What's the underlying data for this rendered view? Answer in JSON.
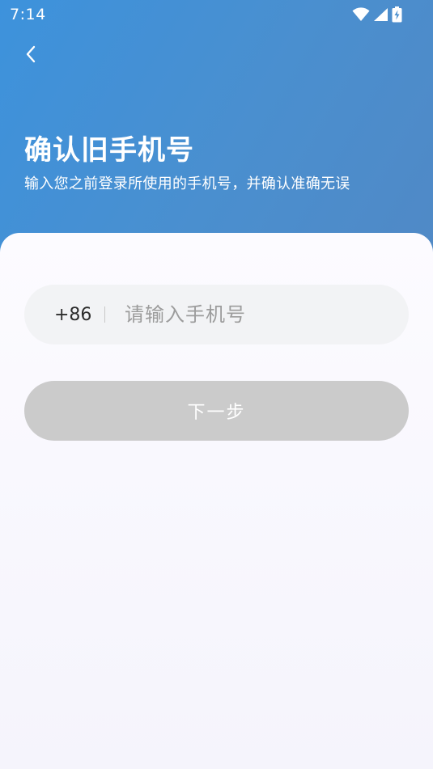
{
  "status_bar": {
    "time": "7:14",
    "icons": [
      "wifi-icon",
      "signal-icon",
      "battery-charging-icon"
    ]
  },
  "header": {
    "back_icon": "chevron-left-icon",
    "title": "确认旧手机号",
    "subtitle": "输入您之前登录所使用的手机号，并确认准确无误"
  },
  "form": {
    "country_code": "+86",
    "phone_value": "",
    "phone_placeholder": "请输入手机号",
    "next_button_label": "下一步"
  },
  "colors": {
    "header_gradient_start": "#3d92dc",
    "header_gradient_end": "#5089c6",
    "input_background": "#f2f3f5",
    "button_disabled": "#cbcbcb",
    "page_background": "#f5f4fb"
  }
}
